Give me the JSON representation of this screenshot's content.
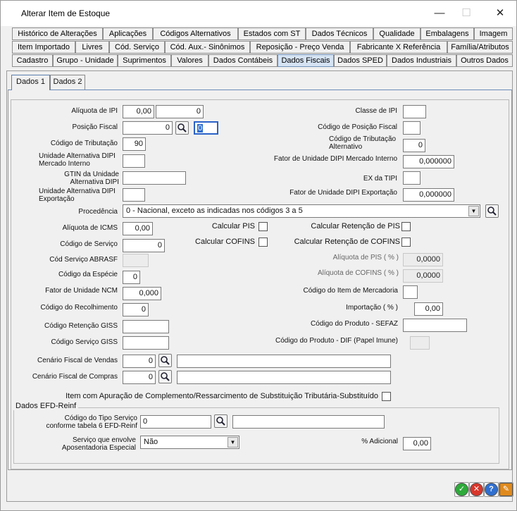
{
  "window": {
    "title": "Alterar Item de Estoque",
    "minimize": "—",
    "maximize": "☐",
    "close": "✕"
  },
  "tabs": {
    "row1": [
      "Histórico de Alterações",
      "Aplicações",
      "Códigos Alternativos",
      "Estados com ST",
      "Dados Técnicos",
      "Qualidade",
      "Embalagens",
      "Imagem"
    ],
    "row2": [
      "Item Importado",
      "Livres",
      "Cód. Serviço",
      "Cód. Aux.- Sinônimos",
      "Reposição - Preço Venda",
      "Fabricante X Referência",
      "Família/Atributos"
    ],
    "row3": [
      "Cadastro",
      "Grupo - Unidade",
      "Suprimentos",
      "Valores",
      "Dados Contábeis",
      "Dados Fiscais",
      "Dados SPED",
      "Dados Industriais",
      "Outros Dados"
    ],
    "active": "Dados Fiscais"
  },
  "subtabs": [
    "Dados 1",
    "Dados 2"
  ],
  "form": {
    "aliquota_ipi": {
      "label": "Alíquota de IPI",
      "value": "0,00",
      "value2": "0"
    },
    "classe_ipi": {
      "label": "Classe de IPI",
      "value": ""
    },
    "posicao_fiscal": {
      "label": "Posição Fiscal",
      "value": "0",
      "value2": "0"
    },
    "codigo_posicao_fiscal": {
      "label": "Código de Posição Fiscal",
      "value": ""
    },
    "codigo_tributacao": {
      "label": "Código de Tributação",
      "value": "90"
    },
    "codigo_tributacao_alt": {
      "label": "Código de Tributação Alternativo",
      "value": "0"
    },
    "unid_alt_dipi_mi": {
      "label": "Unidade Alternativa DIPI Mercado Interno",
      "value": ""
    },
    "fator_dipi_mi": {
      "label": "Fator de Unidade DIPI Mercado Interno",
      "value": "0,000000"
    },
    "gtin": {
      "label": "GTIN da Unidade Alternativa DIPI",
      "value": ""
    },
    "ex_tipi": {
      "label": "EX da TIPI",
      "value": ""
    },
    "unid_alt_dipi_exp": {
      "label": "Unidade Alternativa DIPI Exportação",
      "value": ""
    },
    "fator_dipi_exp": {
      "label": "Fator de Unidade DIPI Exportação",
      "value": "0,000000"
    },
    "procedencia": {
      "label": "Procedência",
      "value": "0 - Nacional, exceto as indicadas nos códigos 3 a 5"
    },
    "aliquota_icms": {
      "label": "Alíquota de ICMS",
      "value": "0,00"
    },
    "calcular_pis": {
      "label": "Calcular PIS"
    },
    "calc_ret_pis": {
      "label": "Calcular Retenção de PIS"
    },
    "codigo_servico": {
      "label": "Código de Serviço",
      "value": "0"
    },
    "calcular_cofins": {
      "label": "Calcular COFINS"
    },
    "calc_ret_cofins": {
      "label": "Calcular Retenção de COFINS"
    },
    "cod_servico_abrasf": {
      "label": "Cód Serviço ABRASF",
      "value": ""
    },
    "aliquota_pis": {
      "label": "Alíquota de PIS   ( % )",
      "value": "0,0000"
    },
    "codigo_especie": {
      "label": "Código da Espécie",
      "value": "0"
    },
    "aliquota_cofins": {
      "label": "Alíquota de COFINS ( % )",
      "value": "0,0000"
    },
    "fator_ncm": {
      "label": "Fator de Unidade NCM",
      "value": "0,000"
    },
    "codigo_item_mercadoria": {
      "label": "Código do Item de Mercadoria",
      "value": ""
    },
    "codigo_recolhimento": {
      "label": "Código do Recolhimento",
      "value": "0"
    },
    "importacao": {
      "label": "Importação ( % )",
      "value": "0,00"
    },
    "codigo_retencao_giss": {
      "label": "Código Retenção GISS",
      "value": ""
    },
    "codigo_produto_sefaz": {
      "label": "Código do Produto - SEFAZ",
      "value": ""
    },
    "codigo_servico_giss": {
      "label": "Código Serviço GISS",
      "value": ""
    },
    "codigo_produto_dif": {
      "label": "Código do Produto - DIF (Papel Imune)",
      "value": ""
    },
    "cenario_vendas": {
      "label": "Cenário Fiscal de Vendas",
      "value": "0",
      "desc": ""
    },
    "cenario_compras": {
      "label": "Cenário Fiscal de Compras",
      "value": "0",
      "desc": ""
    },
    "item_apuracao": {
      "label": "Item com Apuração de Complemento/Ressarcimento de Substituição Tributária-Substituído"
    }
  },
  "efd_reinf": {
    "title": "Dados EFD-Reinf",
    "tipo_servico": {
      "label": "Código do Tipo Serviço conforme tabela 6 EFD-Reinf",
      "value": "0",
      "desc": ""
    },
    "servico_aposentadoria": {
      "label": "Serviço que envolve Aposentadoria Especial",
      "value": "Não"
    },
    "adicional": {
      "label": "% Adicional",
      "value": "0,00"
    }
  },
  "actions": {
    "ok": "✓",
    "cancel": "✕",
    "help": "?",
    "tools": "✎"
  },
  "colors": {
    "active_tab": "#d5e3f3",
    "ok": "#2eaa3a",
    "cancel": "#d8362b",
    "help": "#2f6fd0",
    "tools": "#e08a1c"
  }
}
